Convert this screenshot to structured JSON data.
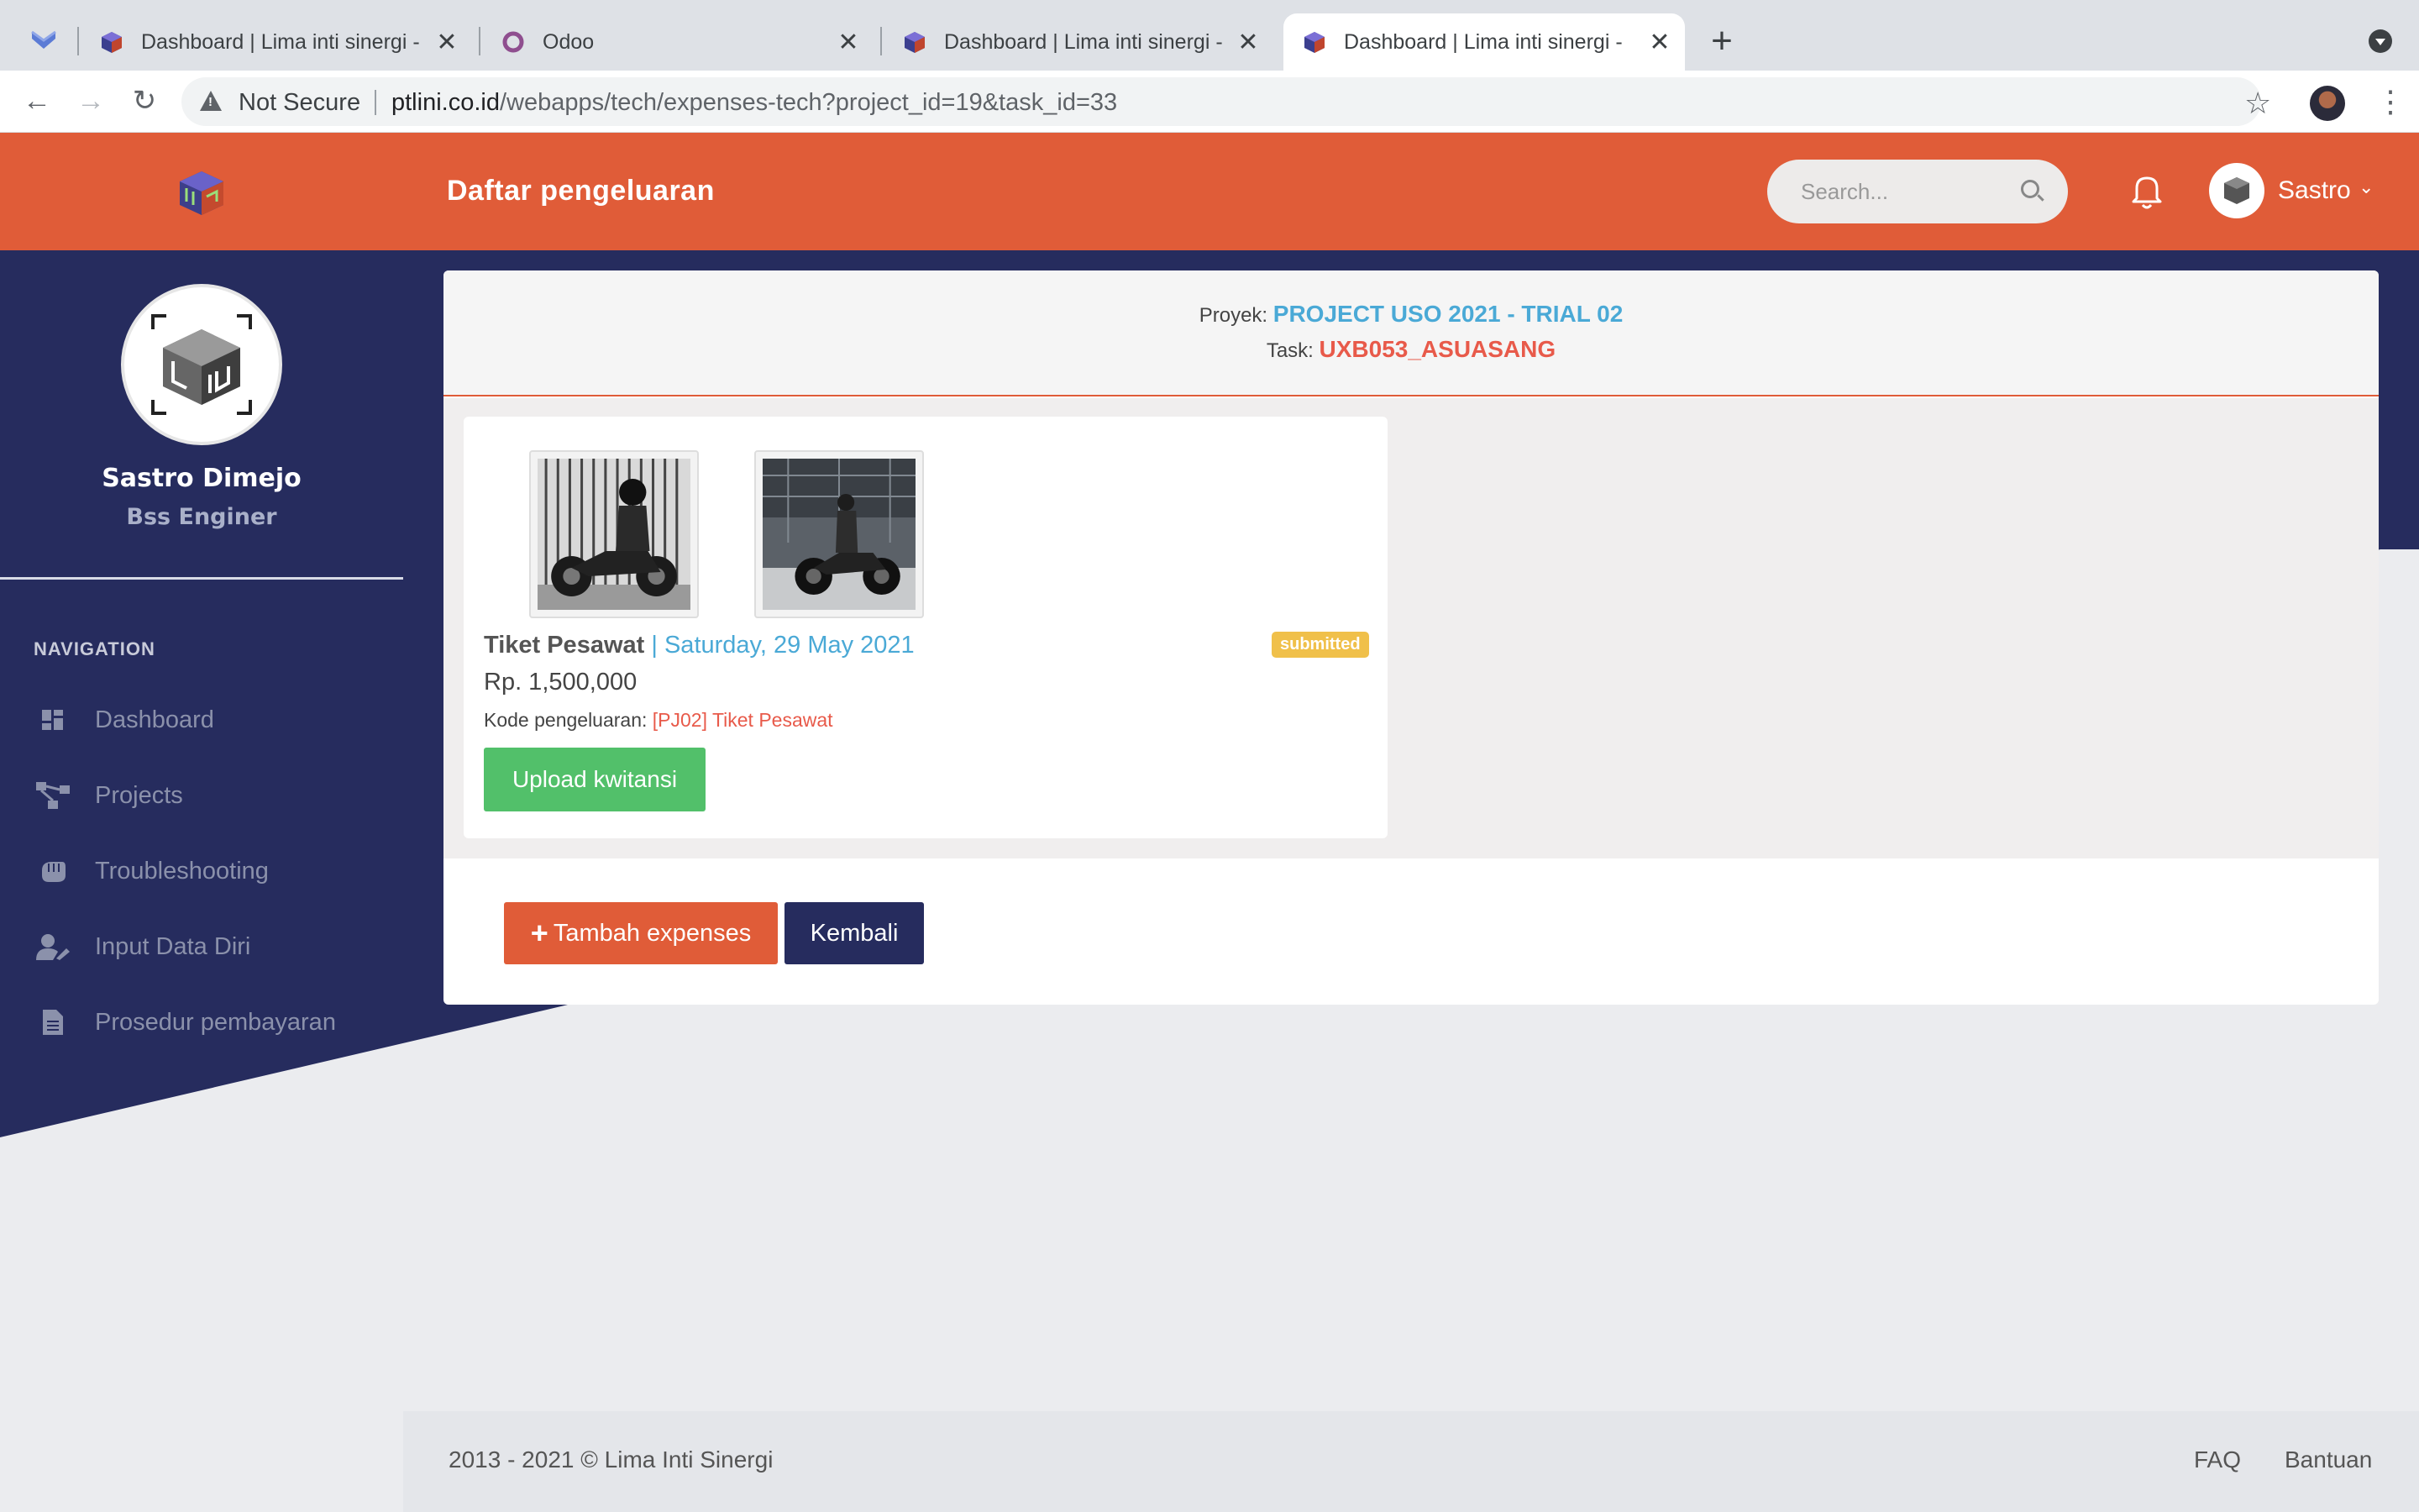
{
  "browser": {
    "tabs": [
      {
        "title": "Dashboard | Lima inti sinergi - ",
        "active": false
      },
      {
        "title": "Odoo",
        "active": false
      },
      {
        "title": "Dashboard | Lima inti sinergi - ",
        "active": false
      },
      {
        "title": "Dashboard | Lima inti sinergi - ",
        "active": true
      }
    ],
    "security_label": "Not Secure",
    "url_domain": "ptlini.co.id",
    "url_path": "/webapps/tech/expenses-tech?project_id=19&task_id=33"
  },
  "header": {
    "page_title": "Daftar pengeluaran",
    "search_placeholder": "Search...",
    "user_name": "Sastro"
  },
  "sidebar": {
    "profile_name": "Sastro Dimejo",
    "profile_role": "Bss Enginer",
    "nav_heading": "NAVIGATION",
    "items": [
      {
        "label": "Dashboard",
        "icon": "dashboard-icon"
      },
      {
        "label": "Projects",
        "icon": "sitemap-icon"
      },
      {
        "label": "Troubleshooting",
        "icon": "hand-icon"
      },
      {
        "label": "Input Data Diri",
        "icon": "user-edit-icon"
      },
      {
        "label": "Prosedur pembayaran",
        "icon": "document-icon"
      }
    ]
  },
  "project": {
    "proyek_label": "Proyek:",
    "proyek_value": "PROJECT USO 2021 - TRIAL 02",
    "task_label": "Task:",
    "task_value": "UXB053_ASUASANG"
  },
  "expense": {
    "name": "Tiket Pesawat",
    "separator": "|",
    "date": "Saturday, 29 May 2021",
    "status": "submitted",
    "amount": "Rp. 1,500,000",
    "code_label": "Kode pengeluaran:",
    "code_value": "[PJ02] Tiket Pesawat",
    "upload_label": "Upload kwitansi"
  },
  "actions": {
    "add_label": "Tambah expenses",
    "back_label": "Kembali"
  },
  "footer": {
    "copyright": "2013 - 2021 © Lima Inti Sinergi",
    "faq": "FAQ",
    "help": "Bantuan"
  },
  "colors": {
    "header": "#e05c38",
    "sidebar": "#262c5e",
    "success": "#52c06a",
    "link": "#4aa9d6",
    "danger": "#e85a4a",
    "badge": "#f0c04a"
  }
}
